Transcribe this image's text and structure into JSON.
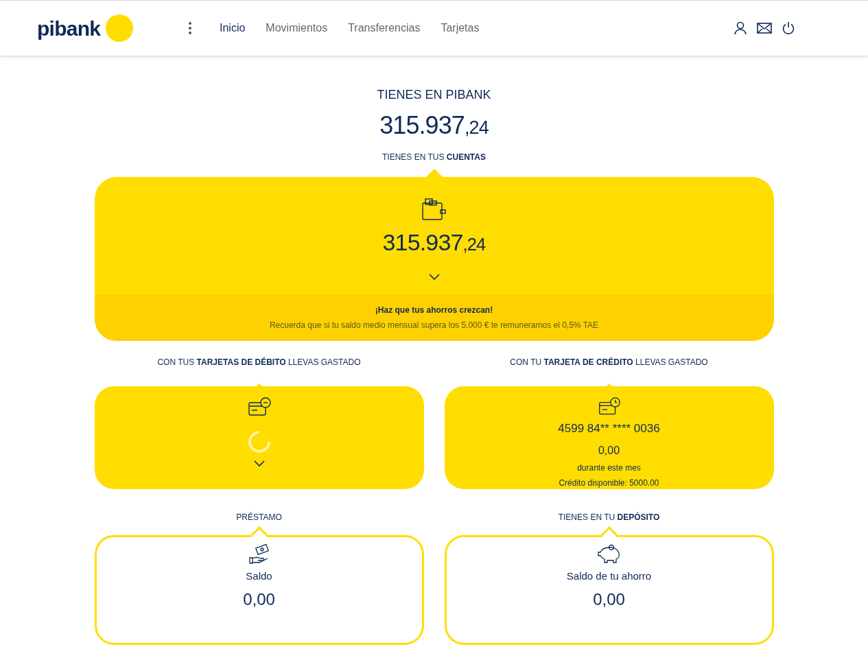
{
  "header": {
    "logo": "pibank",
    "nav": [
      {
        "label": "Inicio",
        "selected": true
      },
      {
        "label": "Movimientos",
        "selected": false
      },
      {
        "label": "Transferencias",
        "selected": false
      },
      {
        "label": "Tarjetas",
        "selected": false
      }
    ]
  },
  "total": {
    "label": "TIENES EN PIBANK",
    "amount": {
      "integer": "315.937",
      "decimals": ",24"
    }
  },
  "accounts": {
    "heading": "TIENES EN TUS **CUENTAS**",
    "amount": {
      "integer": "315.937",
      "decimals": ",24"
    },
    "promo_title": "¡Haz que tus ahorros crezcan!",
    "promo_text": "Recuerda que si tu saldo medio mensual supera los 5.000 € te remuneramos el 0,5% TAE"
  },
  "cards": [
    {
      "kind": "debit",
      "heading": "CON TUS **TARJETAS DE DÉBITO** LLEVAS GASTADO",
      "loading": true
    },
    {
      "kind": "credit",
      "heading": "CON TU **TARJETA DE CRÉDITO** LLEVAS GASTADO",
      "number": "4599 84** **** 0036",
      "amount": "0,00",
      "period": "durante este mes",
      "available": "Crédito disponible: 5000.00"
    }
  ],
  "products": [
    {
      "kind": "loan",
      "heading": "PRÉSTAMO",
      "label": "Saldo",
      "amount": "0,00"
    },
    {
      "kind": "deposit",
      "heading": "TIENES EN TU **DEPÓSITO**",
      "label": "Saldo de tu ahorro",
      "amount": "0,00"
    }
  ]
}
